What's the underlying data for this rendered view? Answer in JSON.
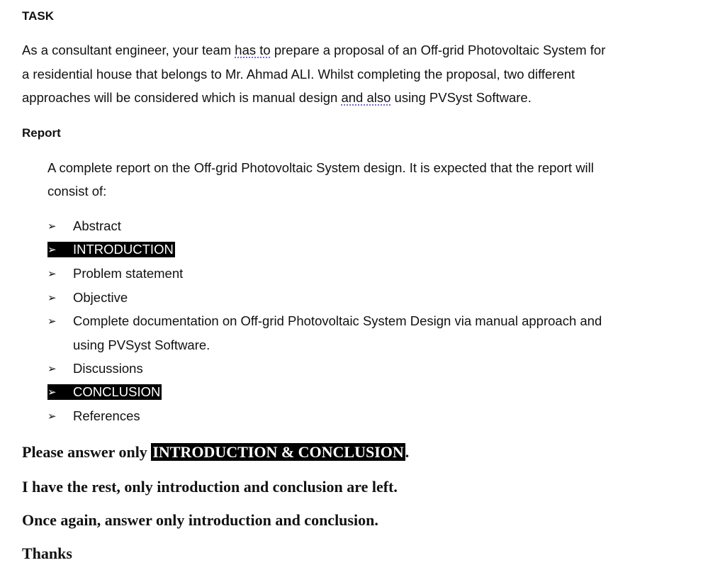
{
  "task": {
    "heading": "TASK",
    "paragraph": {
      "line1_a": "As a consultant engineer, your team ",
      "line1_squiggle": "has to",
      "line1_b": " prepare a proposal of an Off-grid Photovoltaic System for",
      "line2": "a residential house that belongs to Mr. Ahmad ALI. Whilst completing the proposal, two different",
      "line3_a": "approaches will be considered which is manual design ",
      "line3_squiggle": "and also",
      "line3_b": " using PVSyst Software."
    }
  },
  "report": {
    "heading": "Report",
    "intro_line1": "A complete report on the Off-grid Photovoltaic System design. It is expected that the report will",
    "intro_line2": "consist of:",
    "bullet_glyph": "➢",
    "items": [
      {
        "label": "Abstract",
        "highlighted": false
      },
      {
        "label": "INTRODUCTION",
        "highlighted": true
      },
      {
        "label": "Problem statement",
        "highlighted": false
      },
      {
        "label": "Objective",
        "highlighted": false
      },
      {
        "label": "Complete documentation on Off-grid Photovoltaic System Design via manual approach and",
        "continuation": "using PVSyst Software.",
        "highlighted": false
      },
      {
        "label": "Discussions",
        "highlighted": false
      },
      {
        "label": "CONCLUSION",
        "highlighted": true
      },
      {
        "label": "References",
        "highlighted": false
      }
    ]
  },
  "notes": {
    "line1_a": "Please answer only ",
    "line1_highlight": "INTRODUCTION & CONCLUSION",
    "line1_b": ".",
    "line2": "I have the rest, only introduction and conclusion are left.",
    "line3": "Once again, answer only introduction and conclusion.",
    "line4": "Thanks"
  }
}
